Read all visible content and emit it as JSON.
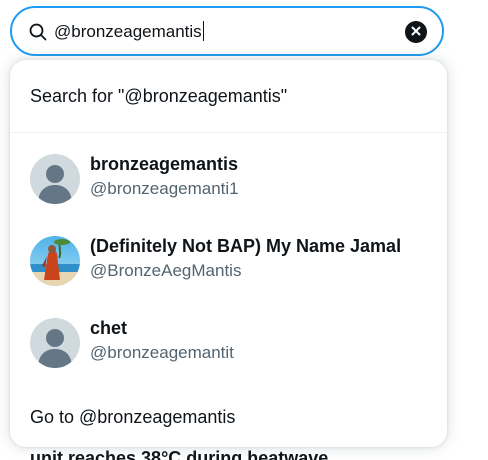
{
  "search": {
    "query": "@bronzeagemantis"
  },
  "dropdown": {
    "search_for": "Search for \"@bronzeagemantis\"",
    "users": [
      {
        "name": "bronzeagemantis",
        "handle": "@bronzeagemanti1",
        "avatar": "default-avatar"
      },
      {
        "name": "(Definitely Not BAP) My Name Jamal",
        "handle": "@BronzeAegMantis",
        "avatar": "photo-avatar"
      },
      {
        "name": "chet",
        "handle": "@bronzeagemantit",
        "avatar": "default-avatar"
      }
    ],
    "goto": "Go to @bronzeagemantis"
  },
  "background": {
    "partial_text": "unit reaches 38°C during heatwave"
  },
  "colors": {
    "accent": "#1d9bf0",
    "text": "#0f1419",
    "secondary_text": "#536471",
    "default_avatar_bg": "#cfd9de",
    "default_avatar_fg": "#657786"
  }
}
